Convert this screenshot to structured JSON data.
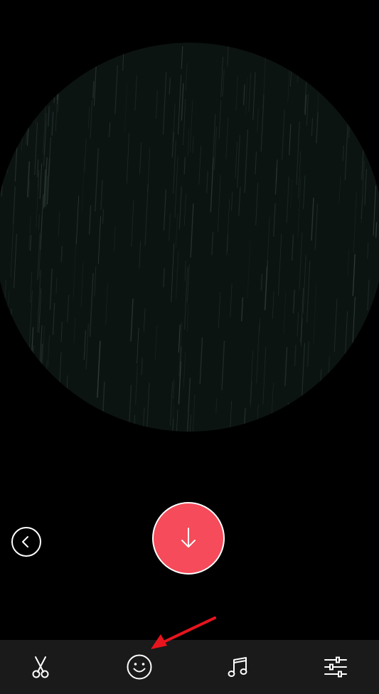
{
  "screen": {
    "background_color": "#000000"
  },
  "preview": {
    "texture": "dark-green-rain-streaks",
    "color": "#0c1412"
  },
  "controls": {
    "back_icon": "chevron-left-icon",
    "download_icon": "arrow-down-icon",
    "download_color": "#f54b5a"
  },
  "toolbar": {
    "background_color": "#1a1a1a",
    "tools": [
      {
        "id": "trim",
        "icon": "scissors-icon"
      },
      {
        "id": "sticker",
        "icon": "smiley-icon"
      },
      {
        "id": "music",
        "icon": "music-note-icon"
      },
      {
        "id": "adjust",
        "icon": "sliders-icon"
      }
    ]
  },
  "annotation": {
    "type": "arrow",
    "color": "#e8141e",
    "target": "smiley-icon"
  }
}
